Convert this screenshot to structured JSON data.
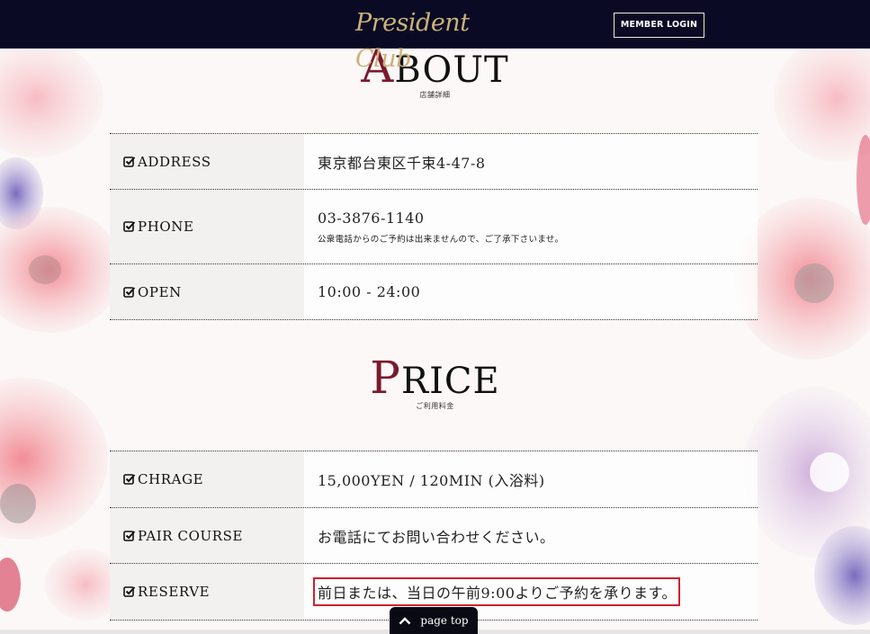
{
  "header": {
    "logo_text": "President Club",
    "login_label": "MEMBER LOGIN"
  },
  "about": {
    "title_first": "A",
    "title_rest": "BOUT",
    "subtitle": "店舗詳細",
    "rows": [
      {
        "label": "ADDRESS",
        "value": "東京都台東区千束4-47-8",
        "note": ""
      },
      {
        "label": "PHONE",
        "value": "03-3876-1140",
        "note": "公衆電話からのご予約は出来ませんので、ご了承下さいませ。"
      },
      {
        "label": "OPEN",
        "value": "10:00 - 24:00",
        "note": ""
      }
    ]
  },
  "price": {
    "title_first": "P",
    "title_rest": "RICE",
    "subtitle": "ご利用料金",
    "rows": [
      {
        "label": "CHRAGE",
        "value": "15,000YEN / 120MIN (入浴料)"
      },
      {
        "label": "PAIR COURSE",
        "value": "お電話にてお問い合わせください。"
      },
      {
        "label": "RESERVE",
        "value": "前日または、当日の午前9:00よりご予約を承ります。"
      }
    ]
  },
  "page_top_label": "page top",
  "colors": {
    "header_bg": "#0a0a24",
    "logo_gold": "#cbb27a",
    "title_accent": "#7a1a2e",
    "highlight_red": "#d4202c"
  }
}
